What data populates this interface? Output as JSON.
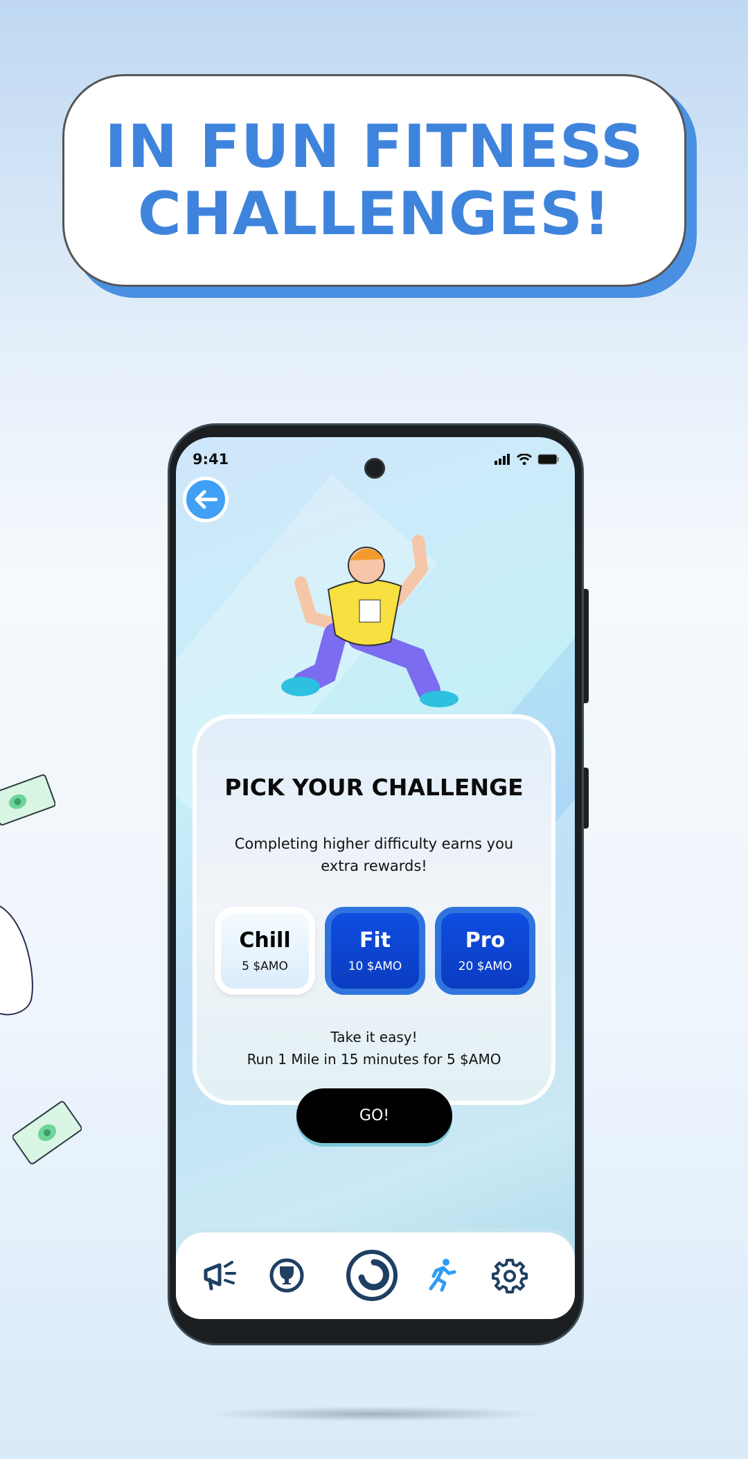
{
  "banner": {
    "line1": "IN FUN FITNESS",
    "line2": "CHALLENGES!"
  },
  "status_bar": {
    "time": "9:41"
  },
  "card": {
    "title": "PICK YOUR CHALLENGE",
    "subtitle_line1": "Completing higher difficulty earns you",
    "subtitle_line2": "extra rewards!",
    "options": [
      {
        "name": "Chill",
        "reward": "5 $AMO",
        "selected": true
      },
      {
        "name": "Fit",
        "reward": "10 $AMO",
        "selected": false
      },
      {
        "name": "Pro",
        "reward": "20 $AMO",
        "selected": false
      }
    ],
    "description_line1": "Take it easy!",
    "description_line2": "Run 1 Mile in 15 minutes for 5 $AMO"
  },
  "go_label": "GO!",
  "nav": {
    "items": [
      {
        "icon": "megaphone-icon",
        "active": false
      },
      {
        "icon": "trophy-icon",
        "active": false
      },
      {
        "icon": "home-logo-icon",
        "active": false
      },
      {
        "icon": "running-icon",
        "active": true
      },
      {
        "icon": "gear-icon",
        "active": false
      }
    ]
  },
  "colors": {
    "accent": "#3f84dc",
    "nav_active": "#2f9bf4",
    "nav_icon": "#1f3f63",
    "button_blue": "#0f4de0"
  }
}
